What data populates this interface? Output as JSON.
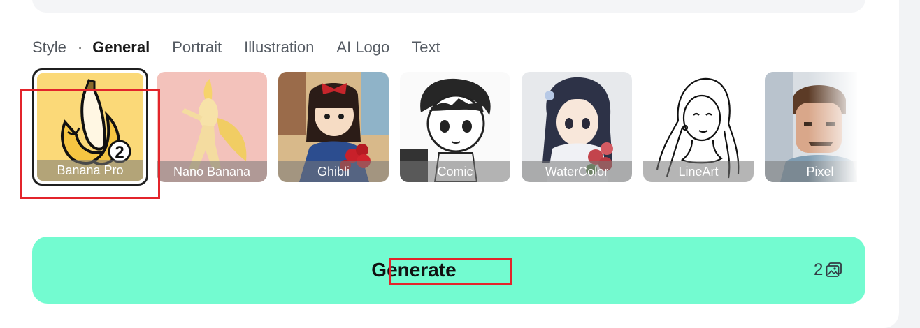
{
  "style_bar": {
    "label": "Style",
    "separator": "·",
    "tabs": [
      "General",
      "Portrait",
      "Illustration",
      "AI Logo",
      "Text"
    ],
    "active_tab": "General"
  },
  "styles": [
    {
      "name": "Banana Pro",
      "selected": true
    },
    {
      "name": "Nano Banana",
      "selected": false
    },
    {
      "name": "Ghibli",
      "selected": false
    },
    {
      "name": "Comic",
      "selected": false
    },
    {
      "name": "WaterColor",
      "selected": false
    },
    {
      "name": "LineArt",
      "selected": false
    },
    {
      "name": "Pixel",
      "selected": false
    }
  ],
  "generate": {
    "label": "Generate",
    "cost": "2",
    "cost_icon": "image-icon"
  },
  "colors": {
    "accent": "#73fbd0",
    "selected_border": "#1f1f1f",
    "highlight": "#e3242b"
  }
}
